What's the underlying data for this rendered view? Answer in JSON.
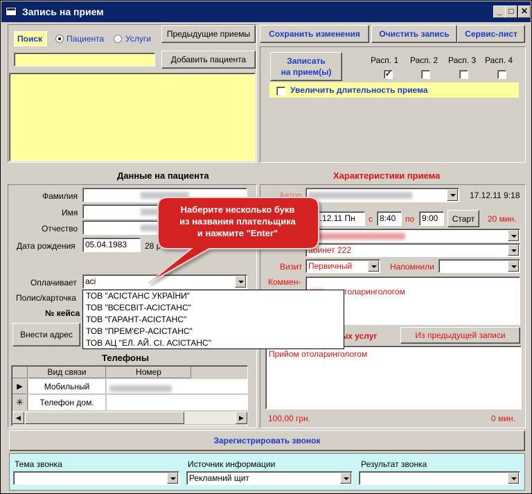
{
  "window": {
    "title": "Запись на прием"
  },
  "search": {
    "label": "Поиск",
    "opt_patients": "Пациента",
    "opt_services": "Услуги",
    "value": ""
  },
  "left_buttons": {
    "prev": "Предыдущие приемы",
    "add_patient": "Добавить пациента"
  },
  "top_buttons": {
    "save": "Сохранить изменения",
    "clear": "Очистить запись",
    "service": "Сервис-лист"
  },
  "schedule": {
    "book_btn": "Записать\nна прием(ы)",
    "r1": "Расп. 1",
    "r2": "Расп. 2",
    "r3": "Расп. 3",
    "r4": "Расп. 4",
    "extend": "Увеличить длительность приема"
  },
  "patient": {
    "header": "Данные на пациента",
    "surname": "Фамилия",
    "name": "Имя",
    "patronymic": "Отчество",
    "dob_label": "Дата рождения",
    "dob": "05.04.1983",
    "age": "28 р",
    "payer_label": "Оплачивает",
    "payer_value": "aci",
    "policy_label": "Полис/карточка",
    "case_label": "№ кейса",
    "address_btn": "Внести адрес"
  },
  "payer_options": [
    "ТОВ \"АСІСТАНС УКРАЇНИ\"",
    "ТОВ \"ВСЕСВІТ-АСІСТАНС\"",
    "ТОВ \"ГАРАНТ-АСІСТАНС\"",
    "ТОВ \"ПРЕМ'ЄР-АСІСТАНС\"",
    "ТОВ АЦ \"ЕЛ. АЙ. СІ. АСІСТАНС\""
  ],
  "phones": {
    "header": "Телефоны",
    "col_type": "Вид связи",
    "col_num": "Номер",
    "rows": [
      "Мобильный",
      "Телефон дом."
    ]
  },
  "tooltip": "Наберите несколько букв\nиз названия плательщика\nи нажмите \"Enter\"",
  "appt": {
    "header": "Характеристики приема",
    "author_label": "Автор",
    "date_time": "17.12.11 9:18",
    "date": "9.12.11 Пн",
    "from_label": "с",
    "from": "8:40",
    "to_label": "по",
    "to": "9:00",
    "start_btn": "Старт",
    "duration": "20 мин.",
    "cabinet": "абинет 222",
    "visit_label": "Визит",
    "visit_value": "Первичный",
    "remind_label": "Напомнили",
    "comment_label": "Коммен-",
    "comment_text": "ом отоларингологом",
    "services_label": "ых услуг",
    "prev_btn": "Из предыдущей записи",
    "service_text": "Прийом отоларингологом",
    "price": "100,00 грн.",
    "total_min": "0 мин."
  },
  "register_btn": "Зарегистрировать звонок",
  "call": {
    "topic_label": "Тема звонка",
    "source_label": "Источник информации",
    "source_value": "Рекламний щит",
    "result_label": "Результат звонка"
  },
  "colors": {
    "accent": "#1a3acb",
    "red": "#e01010",
    "tooltip": "#d42020"
  }
}
